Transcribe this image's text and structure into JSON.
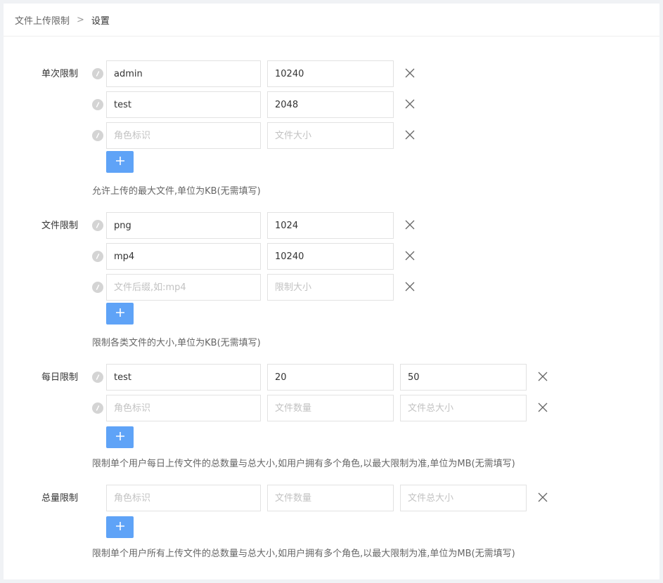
{
  "breadcrumb": {
    "parent": "文件上传限制",
    "separator": ">",
    "current": "设置"
  },
  "single_limit": {
    "label": "单次限制",
    "rows": [
      {
        "role": "admin",
        "size": "10240"
      },
      {
        "role": "test",
        "size": "2048"
      },
      {
        "role": "",
        "size": ""
      }
    ],
    "placeholders": {
      "role": "角色标识",
      "size": "文件大小"
    },
    "help": "允许上传的最大文件,单位为KB(无需填写)"
  },
  "file_limit": {
    "label": "文件限制",
    "rows": [
      {
        "ext": "png",
        "size": "1024"
      },
      {
        "ext": "mp4",
        "size": "10240"
      },
      {
        "ext": "",
        "size": ""
      }
    ],
    "placeholders": {
      "ext": "文件后缀,如:mp4",
      "size": "限制大小"
    },
    "help": "限制各类文件的大小,单位为KB(无需填写)"
  },
  "daily_limit": {
    "label": "每日限制",
    "rows": [
      {
        "role": "test",
        "count": "20",
        "total": "50"
      },
      {
        "role": "",
        "count": "",
        "total": ""
      }
    ],
    "placeholders": {
      "role": "角色标识",
      "count": "文件数量",
      "total": "文件总大小"
    },
    "help": "限制单个用户每日上传文件的总数量与总大小,如用户拥有多个角色,以最大限制为准,单位为MB(无需填写)"
  },
  "total_limit": {
    "label": "总量限制",
    "rows": [
      {
        "role": "",
        "count": "",
        "total": ""
      }
    ],
    "placeholders": {
      "role": "角色标识",
      "count": "文件数量",
      "total": "文件总大小"
    },
    "help": "限制单个用户所有上传文件的总数量与总大小,如用户拥有多个角色,以最大限制为准,单位为MB(无需填写)"
  },
  "icons": {
    "drag": "drag-handle-icon",
    "remove": "close-icon",
    "add": "plus-icon"
  },
  "colors": {
    "accent": "#5fa3f7",
    "border": "#e2e2e2",
    "handle": "#d4d4d4"
  }
}
